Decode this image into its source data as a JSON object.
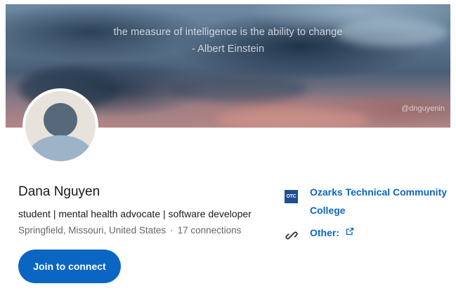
{
  "banner": {
    "quote_line1": "the measure of intelligence is the ability to change",
    "quote_line2": "- Albert Einstein",
    "handle": "@dnguyenin"
  },
  "profile": {
    "name": "Dana Nguyen",
    "headline": "student | mental health advocate | software developer",
    "location": "Springfield, Missouri, United States",
    "separator": "·",
    "connections": "17 connections"
  },
  "actions": {
    "join_label": "Join to connect"
  },
  "sidebar": {
    "education": {
      "logo_text": "OTC",
      "name": "Ozarks Technical Community College"
    },
    "other_link_label": "Other:"
  },
  "colors": {
    "accent": "#0a66c2",
    "text_primary": "#191919",
    "text_secondary": "#666666"
  },
  "icons": [
    "link-icon",
    "external-link-icon"
  ]
}
